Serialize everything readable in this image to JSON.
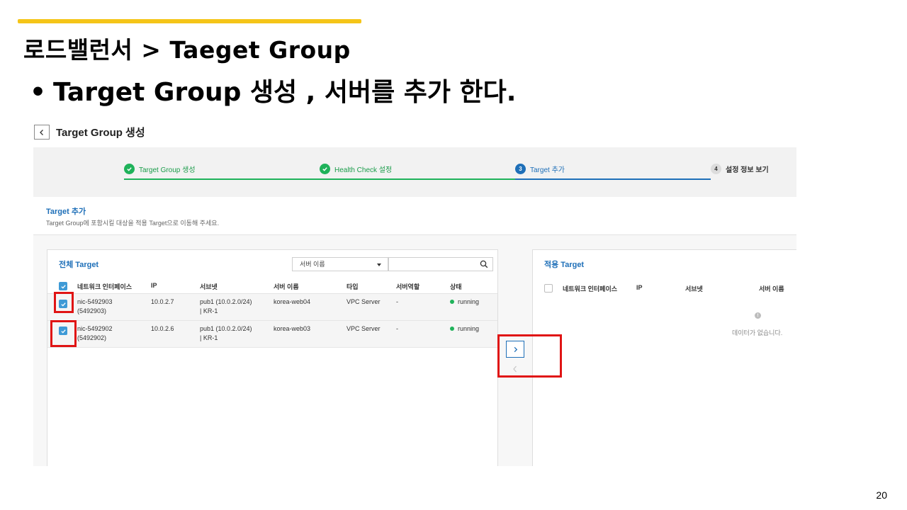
{
  "slide": {
    "title": "로드밸런서  >  Taeget Group",
    "bullet_symbol": "•",
    "bullet": "Target Group 생성 , 서버를 추가 한다.",
    "page_number": "20",
    "accent_color": "#f5c518",
    "highlight_color": "#e01414"
  },
  "screen": {
    "page_heading": "Target Group 생성",
    "steps": [
      {
        "label": "Target Group 생성",
        "state": "done"
      },
      {
        "label": "Health Check 설정",
        "state": "done"
      },
      {
        "number": "3",
        "label": "Target 추가",
        "state": "active"
      },
      {
        "number": "4",
        "label": "설정 정보 보기",
        "state": "todo"
      }
    ],
    "section": {
      "title": "Target 추가",
      "description": "Target Group에 포함시킬 대상을 적용 Target으로 이동해 주세요."
    },
    "all_targets": {
      "title": "전체 Target",
      "filter_select": "서버 이름",
      "search_value": "",
      "columns": [
        "네트워크 인터페이스",
        "IP",
        "서브넷",
        "서버 이름",
        "타입",
        "서버역할",
        "상태"
      ],
      "rows": [
        {
          "nic": "nic-5492903",
          "nic_id": "(5492903)",
          "ip": "10.0.2.7",
          "subnet": "pub1 (10.0.2.0/24)",
          "subnet_zone": "| KR-1",
          "server": "korea-web04",
          "type": "VPC Server",
          "role": "-",
          "status": "running",
          "checked": true
        },
        {
          "nic": "nic-5492902",
          "nic_id": "(5492902)",
          "ip": "10.0.2.6",
          "subnet": "pub1 (10.0.2.0/24)",
          "subnet_zone": "| KR-1",
          "server": "korea-web03",
          "type": "VPC Server",
          "role": "-",
          "status": "running",
          "checked": true
        }
      ]
    },
    "applied_targets": {
      "title": "적용 Target",
      "columns": [
        "네트워크 인터페이스",
        "IP",
        "서브넷",
        "서버 이름"
      ],
      "empty_icon": "!",
      "empty_text": "데이터가 없습니다."
    },
    "colors": {
      "primary": "#1e6fb8",
      "success": "#1fb25a",
      "checkbox": "#3e9ad6"
    }
  }
}
